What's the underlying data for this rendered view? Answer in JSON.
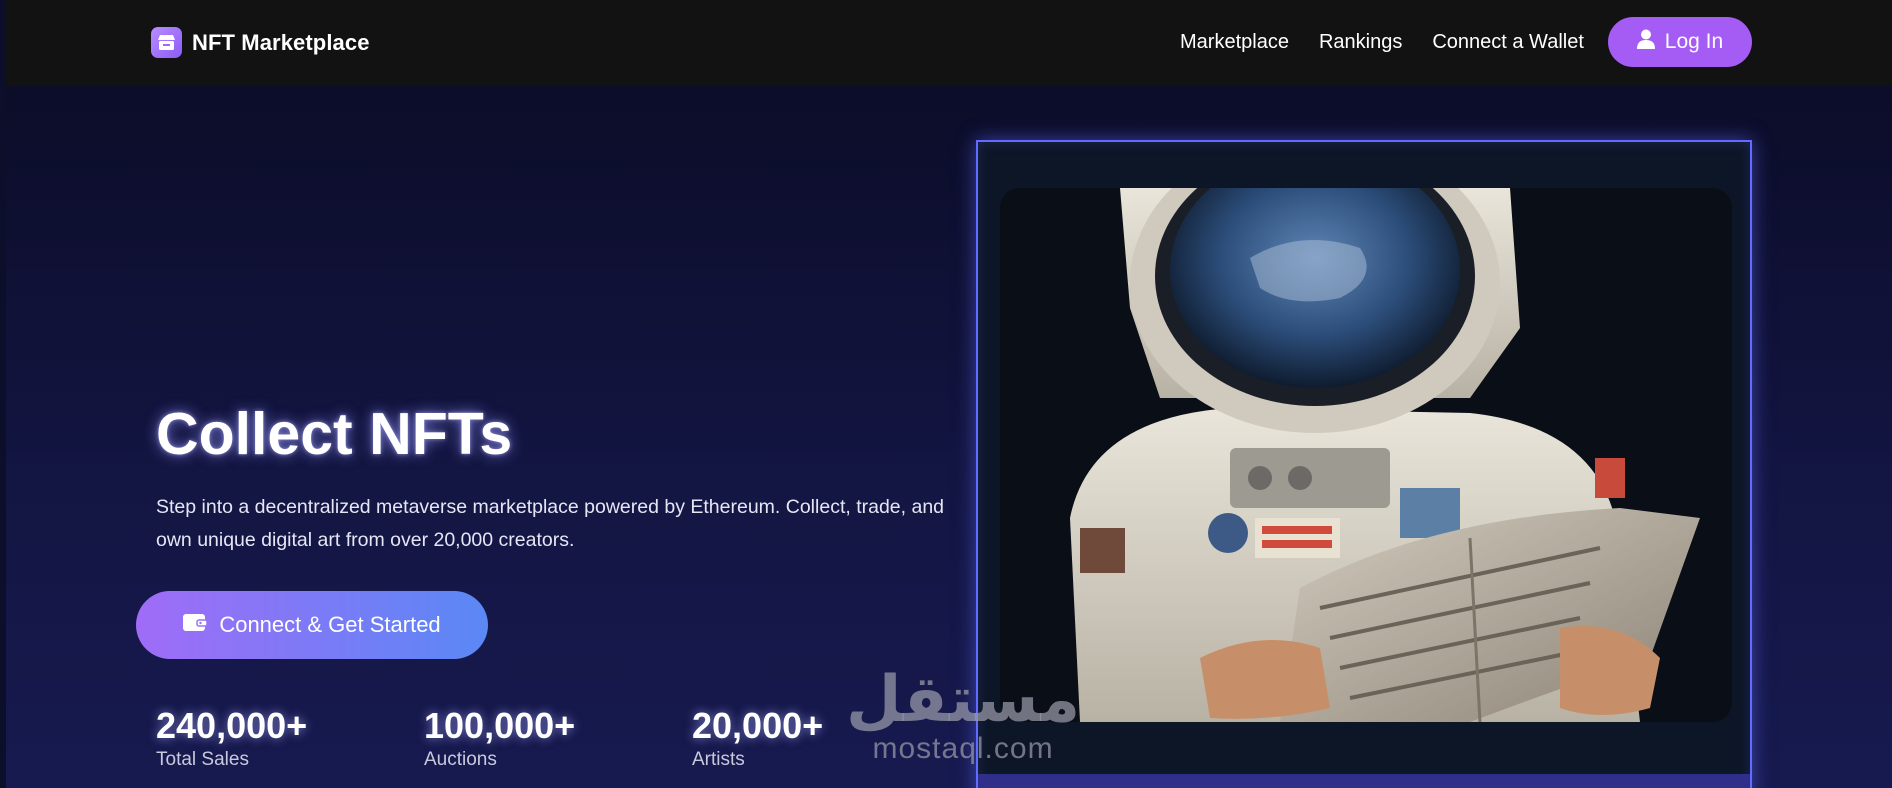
{
  "header": {
    "brand": "NFT Marketplace",
    "nav": [
      "Marketplace",
      "Rankings",
      "Connect a Wallet"
    ],
    "login_label": "Log In"
  },
  "hero": {
    "title": "Collect NFTs",
    "description": "Step into a decentralized metaverse marketplace powered by Ethereum. Collect, trade, and own unique digital art from over 20,000 creators.",
    "cta_label": "Connect & Get Started"
  },
  "stats": [
    {
      "value": "240,000+",
      "label": "Total Sales"
    },
    {
      "value": "100,000+",
      "label": "Auctions"
    },
    {
      "value": "20,000+",
      "label": "Artists"
    }
  ],
  "watermark": {
    "arabic": "مستقل",
    "latin": "mostaql.com"
  },
  "icons": {
    "brand": "storefront-icon",
    "login": "user-icon",
    "cta": "wallet-icon"
  },
  "colors": {
    "accent": "#a45cf5",
    "cta_gradient_start": "#a06cf7",
    "cta_gradient_end": "#5a88f5",
    "frame_border": "#5f6cff",
    "navbar_bg": "#121212",
    "page_bg": "#0d0e2a"
  }
}
